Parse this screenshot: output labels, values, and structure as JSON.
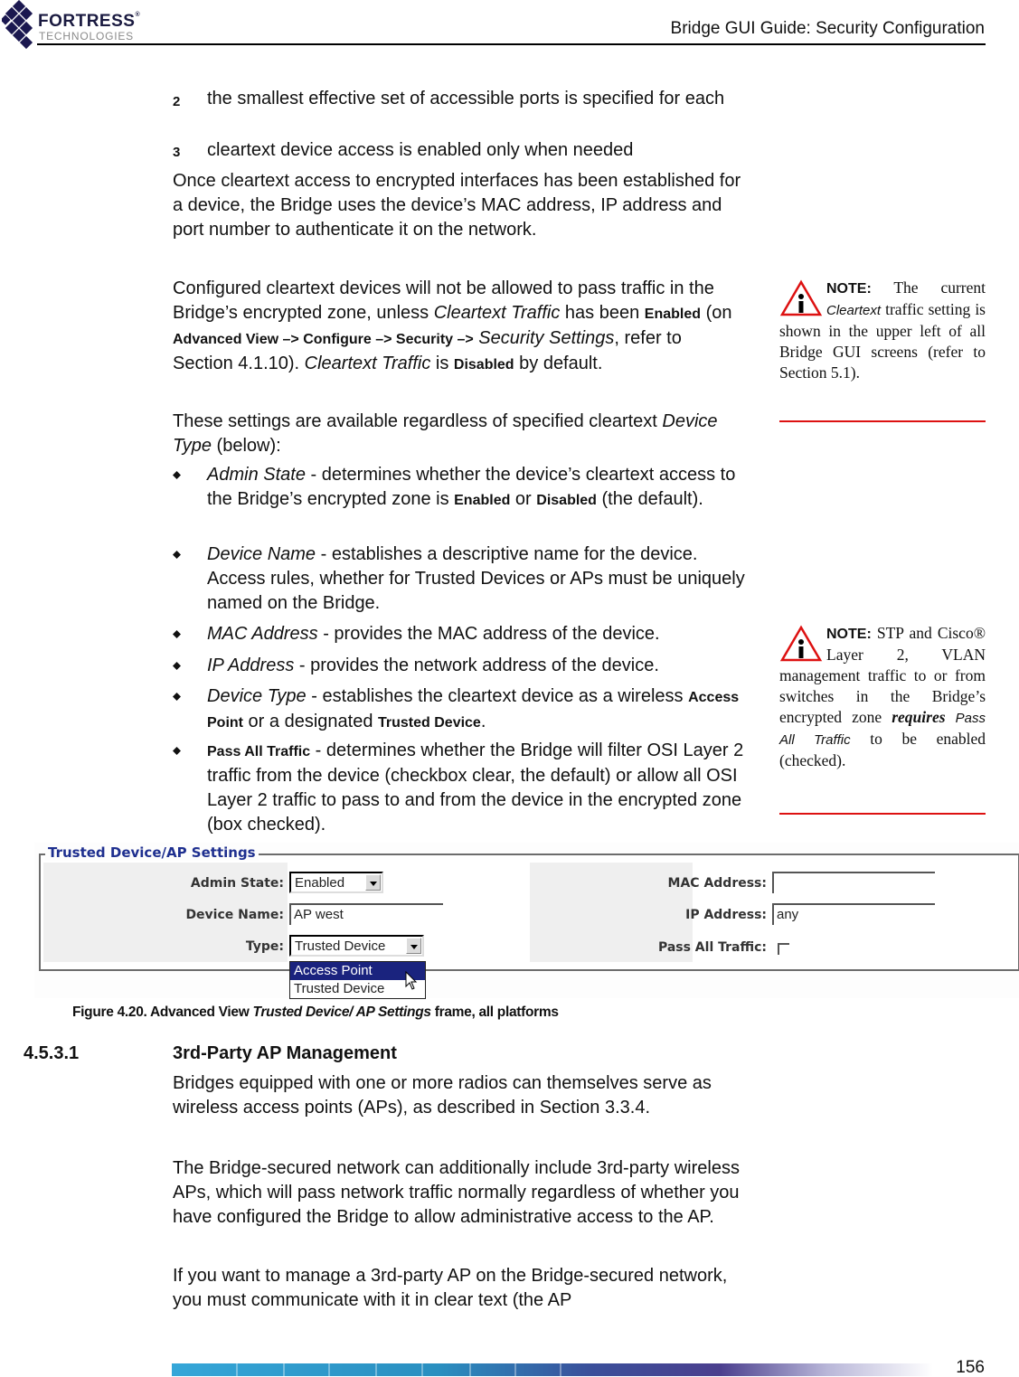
{
  "header": {
    "logo_line1": "FORTRESS",
    "logo_reg": "®",
    "logo_line2": "TECHNOLOGIES",
    "title": "Bridge GUI Guide: Security Configuration"
  },
  "numbered_items": [
    {
      "num": "2",
      "text": "the smallest effective set of accessible ports is specified for each"
    },
    {
      "num": "3",
      "text": "cleartext device access is enabled only when needed"
    }
  ],
  "paragraphs": {
    "p1": "Once cleartext access to encrypted interfaces has been established for a device, the Bridge uses the device’s MAC address, IP address and port number to authenticate it on the network.",
    "p2": {
      "t1": "Configured cleartext devices will not be allowed to pass traffic in the Bridge’s encrypted zone, unless ",
      "i1": "Cleartext Traffic",
      "t2": " has been ",
      "b1": "Enabled",
      "t3": " (on ",
      "b2": "Advanced View –> Configure –> Security –>",
      "t4": " ",
      "i2": "Security Settings",
      "t5": ", refer to Section 4.1.10). ",
      "i3": "Cleartext Traffic",
      "t6": " is ",
      "b3": "Disabled",
      "t7": " by default."
    },
    "p3": {
      "t1": "These settings are available regardless of specified cleartext ",
      "i1": "Device Type",
      "t2": " (below):"
    }
  },
  "bullets": [
    {
      "term": "Admin State",
      "t1": " - determines whether the device’s cleartext access to the Bridge’s encrypted zone is ",
      "b1": "Enabled",
      "t2": " or ",
      "b2": "Disabled",
      "t3": " (the default)."
    },
    {
      "term": "Device Name",
      "t1": " - establishes a descriptive name for the device. Access rules, whether for Trusted Devices or APs must be uniquely named on the Bridge."
    },
    {
      "term": "MAC Address",
      "t1": " - provides the MAC address of the device."
    },
    {
      "term": "IP Address",
      "t1": " - provides the network address of the device."
    },
    {
      "term": "Device Type",
      "t1": " - establishes the cleartext device as a wireless ",
      "b1": "Access Point",
      "t2": " or a designated ",
      "b2": "Trusted Device",
      "t3": "."
    },
    {
      "term": "Pass All Traffic",
      "t1": " - determines whether the Bridge will filter OSI Layer 2 traffic from the device (checkbox clear, the default) or allow all OSI Layer 2 traffic to pass to and from the device in the encrypted zone (box checked)."
    }
  ],
  "notes": [
    {
      "label": "NOTE:",
      "t1": " The current ",
      "i1": "Cleartext",
      "t2": " traffic setting is shown in the upper left of all Bridge GUI screens (refer to Section 5.1)."
    },
    {
      "label": "NOTE:",
      "t1": " STP and Cisco® Layer 2, VLAN management traffic to or from switches in the Bridge’s encrypted zone ",
      "bi1": "requires",
      "t2": " ",
      "i1": "Pass All Traffic",
      "t3": " to be enabled (checked)."
    }
  ],
  "figure": {
    "frame_title": "Trusted Device/AP Settings",
    "admin_state": {
      "label": "Admin State:",
      "value": "Enabled"
    },
    "device_name": {
      "label": "Device Name:",
      "value": "AP west"
    },
    "type": {
      "label": "Type:",
      "value": "Trusted Device",
      "options": [
        "Access Point",
        "Trusted Device"
      ],
      "highlighted": "Access Point"
    },
    "mac_address": {
      "label": "MAC Address:",
      "value": ""
    },
    "ip_address": {
      "label": "IP Address:",
      "value": "any"
    },
    "pass_all_traffic": {
      "label": "Pass All Traffic:",
      "checked": false
    },
    "caption": {
      "t1": "Figure 4.20. Advanced View ",
      "i1": "Trusted Device/ AP Settings",
      "t2": " frame, all platforms"
    }
  },
  "section": {
    "number": "4.5.3.1",
    "title": "3rd-Party AP Management",
    "paragraphs": [
      "Bridges equipped with one or more radios can themselves serve as wireless access points (APs), as described in Section 3.3.4.",
      "The Bridge-secured network can additionally include 3rd-party wireless APs, which will pass network traffic normally regardless of whether you have configured the Bridge to allow administrative access to the AP.",
      "If you want to manage a 3rd-party AP on the Bridge-secured network, you must communicate with it in clear text (the AP"
    ]
  },
  "footer": {
    "page_number": "156"
  },
  "colors": {
    "note_accent": "#dd1111",
    "frame_title": "#1e2f8f",
    "dropdown_highlight": "#1a237e"
  }
}
